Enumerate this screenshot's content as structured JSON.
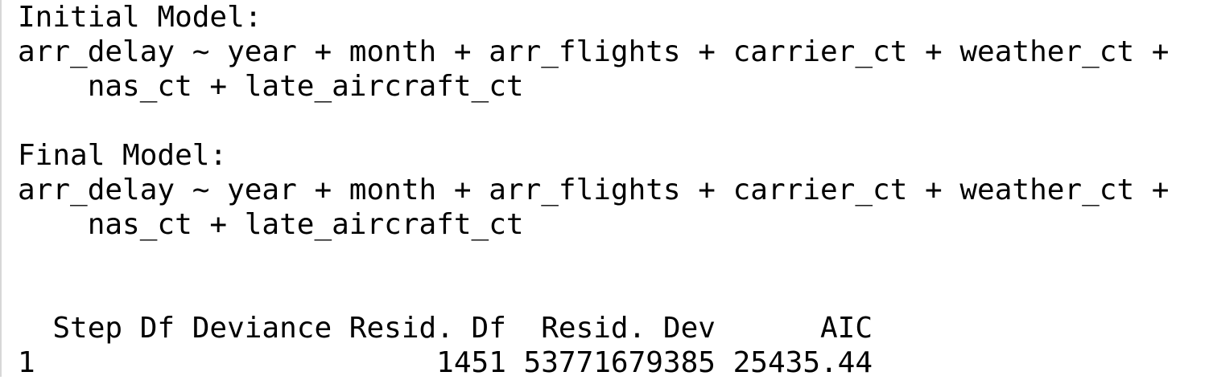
{
  "console": {
    "lines": [
      "Initial Model:",
      "arr_delay ~ year + month + arr_flights + carrier_ct + weather_ct +",
      "    nas_ct + late_aircraft_ct",
      "",
      "Final Model:",
      "arr_delay ~ year + month + arr_flights + carrier_ct + weather_ct +",
      "    nas_ct + late_aircraft_ct",
      "",
      "",
      "  Step Df Deviance Resid. Df  Resid. Dev      AIC",
      "1                       1451 53771679385 25435.44"
    ]
  }
}
